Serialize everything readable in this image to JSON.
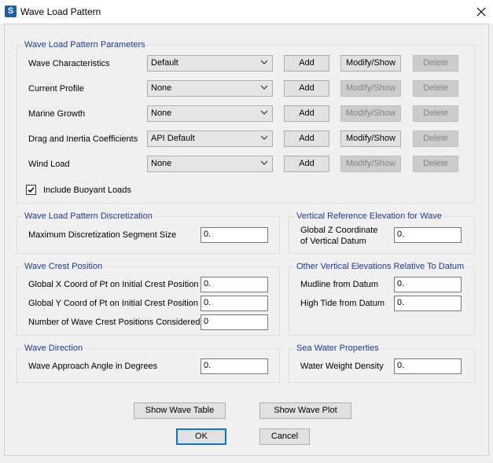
{
  "window": {
    "title": "Wave Load Pattern",
    "app_icon": "S"
  },
  "params": {
    "legend": "Wave Load Pattern Parameters",
    "rows": [
      {
        "label": "Wave Characteristics",
        "value": "Default",
        "add": "Add",
        "modify": "Modify/Show",
        "delete": "Delete"
      },
      {
        "label": "Current Profile",
        "value": "None",
        "add": "Add",
        "modify": "Modify/Show",
        "delete": "Delete"
      },
      {
        "label": "Marine Growth",
        "value": "None",
        "add": "Add",
        "modify": "Modify/Show",
        "delete": "Delete"
      },
      {
        "label": "Drag and Inertia Coefficients",
        "value": "API Default",
        "add": "Add",
        "modify": "Modify/Show",
        "delete": "Delete"
      },
      {
        "label": "Wind Load",
        "value": "None",
        "add": "Add",
        "modify": "Modify/Show",
        "delete": "Delete"
      }
    ],
    "buoyant_label": "Include Buoyant Loads",
    "buoyant_checked": true
  },
  "discretization": {
    "legend": "Wave Load Pattern Discretization",
    "label": "Maximum Discretization Segment Size",
    "value": "0."
  },
  "vertical_ref": {
    "legend": "Vertical Reference Elevation for Wave",
    "label_line1": "Global Z Coordinate",
    "label_line2": "of Vertical Datum",
    "value": "0."
  },
  "crest": {
    "legend": "Wave Crest Position",
    "x_label": "Global X Coord of Pt on Initial Crest Position",
    "x_value": "0.",
    "y_label": "Global Y Coord of Pt on Initial Crest Position",
    "y_value": "0.",
    "n_label": "Number of Wave Crest Positions Considered",
    "n_value": "0"
  },
  "other_elev": {
    "legend": "Other Vertical Elevations Relative To Datum",
    "mudline_label": "Mudline from Datum",
    "mudline_value": "0.",
    "hightide_label": "High Tide from Datum",
    "hightide_value": "0."
  },
  "direction": {
    "legend": "Wave Direction",
    "label": "Wave Approach Angle in Degrees",
    "value": "0."
  },
  "sea_water": {
    "legend": "Sea Water Properties",
    "label": "Water Weight Density",
    "value": "0."
  },
  "buttons": {
    "show_table": "Show Wave Table",
    "show_plot": "Show Wave Plot",
    "ok": "OK",
    "cancel": "Cancel"
  }
}
